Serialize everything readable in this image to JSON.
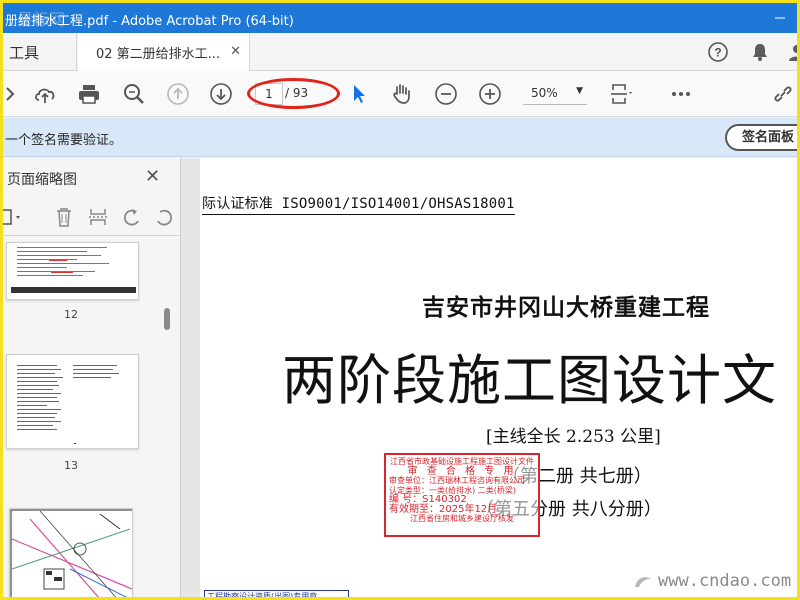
{
  "window": {
    "title": "册给排水工程.pdf - Adobe Acrobat Pro (64-bit)",
    "title_watermark": "星标网"
  },
  "tabs": {
    "tools_label": "工具",
    "doc_label": "02 第二册给排水工..."
  },
  "toolbar": {
    "current_page": "1",
    "total_pages": "/ 93",
    "zoom": "50%"
  },
  "signature_banner": {
    "message": "一个签名需要验证。",
    "button_label": "签名面板"
  },
  "side_panel": {
    "title": "页面缩略图",
    "thumbnails": [
      {
        "page": "12"
      },
      {
        "page": "13"
      }
    ]
  },
  "document": {
    "certification": "际认证标准 ISO9001/ISO14001/OHSAS18001",
    "project_name": "吉安市井冈山大桥重建工程",
    "main_title": "两阶段施工图设计文",
    "main_line": "[主线全长 2.253 公里]",
    "volume_1": "（第二册  共七册）",
    "volume_2": "（第五分册  共八分册）",
    "stamp": {
      "line1": "江西省市政基础设施工程施工图设计文件",
      "line2": "审 查 合 格 专 用",
      "line3": "审查单位：江西瑞林工程咨询有限公司",
      "line4": "认定类型：一类(给排水) 二类(桥梁)",
      "line5": "编  号：S140302",
      "line6": "有效期至：2025年12月",
      "line7": "江西省住房和城乡建设厅核发"
    },
    "bottom_label": "工程勘察设计资质(出图)专用章"
  },
  "watermark_site": "www.cndao.com",
  "colors": {
    "titlebar": "#1e78d7",
    "highlight_ellipse": "#e2231a",
    "banner": "#d8e8f8",
    "stamp_red": "#d6262e"
  }
}
